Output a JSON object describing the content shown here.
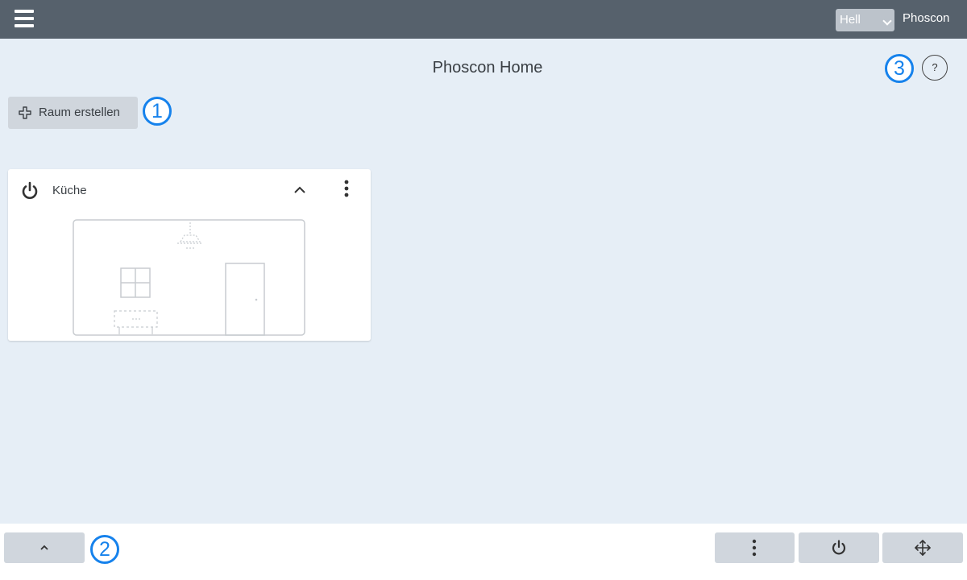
{
  "header": {
    "menu_icon": "hamburger-menu-icon",
    "theme_select_value": "Hell",
    "brand": "Phoscon"
  },
  "page": {
    "title": "Phoscon Home",
    "help_label": "?"
  },
  "toolbar": {
    "add_room_label": "Raum erstellen",
    "add_room_icon": "plus-icon"
  },
  "rooms": [
    {
      "name": "Küche",
      "power_icon": "power-icon",
      "collapse_icon": "chevron-up-icon",
      "menu_icon": "more-vertical-icon"
    }
  ],
  "bottom_bar": {
    "buttons": [
      "chevron-up-icon",
      "more-vertical-icon",
      "power-icon",
      "move-icon"
    ]
  },
  "callouts": [
    "1",
    "2",
    "3"
  ],
  "colors": {
    "header_bg": "#56616c",
    "page_bg": "#e6eef6",
    "button_bg": "#d0d6dd",
    "callout": "#1682ec"
  }
}
